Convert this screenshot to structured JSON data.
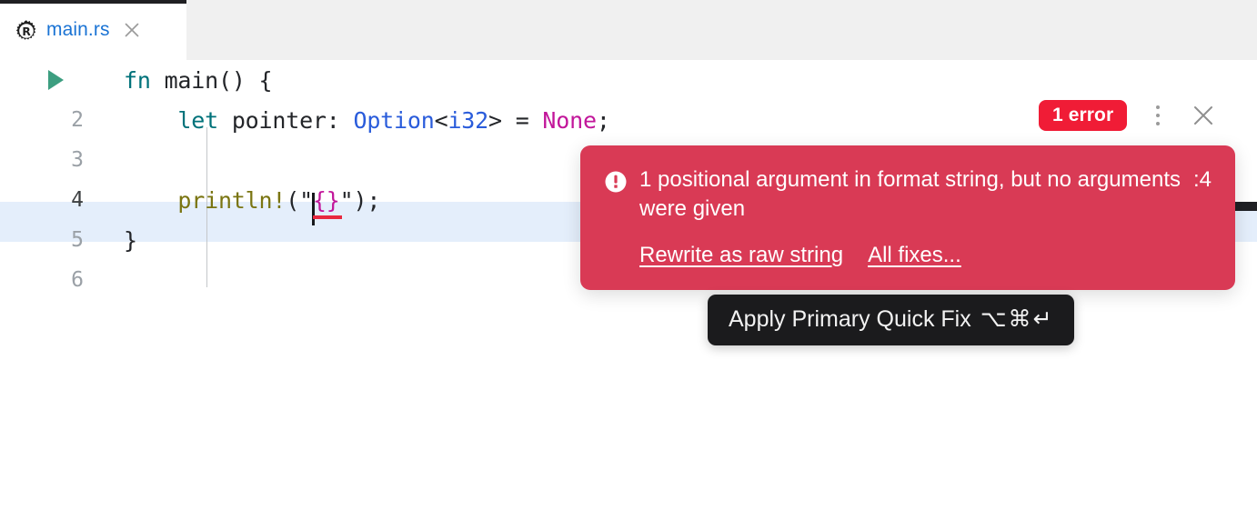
{
  "window": {
    "background_color": "#ffffff",
    "tabbar_background_color": "#f0f0f0"
  },
  "tabbar": {
    "tabs": [
      {
        "label": "main.rs",
        "icon": "rust-file-icon",
        "active": true,
        "close_icon": "close-icon",
        "label_color": "#1a73d4"
      }
    ]
  },
  "editor": {
    "current_line": 4,
    "current_line_highlight_color": "#e4eefb",
    "run_gutter_icon": "run-arrow-icon",
    "lines": [
      {
        "number": "1",
        "number_visible": false,
        "has_run_marker": true,
        "tokens": [
          {
            "text": "fn ",
            "style": "kw"
          },
          {
            "text": "main",
            "style": "plain"
          },
          {
            "text": "() {",
            "style": "plain"
          }
        ]
      },
      {
        "number": "2",
        "number_visible": true,
        "has_run_marker": false,
        "tokens": [
          {
            "text": "    ",
            "style": "plain"
          },
          {
            "text": "let ",
            "style": "kw"
          },
          {
            "text": "pointer: ",
            "style": "plain"
          },
          {
            "text": "Option",
            "style": "type"
          },
          {
            "text": "<",
            "style": "plain"
          },
          {
            "text": "i32",
            "style": "type"
          },
          {
            "text": "> = ",
            "style": "plain"
          },
          {
            "text": "None",
            "style": "lit"
          },
          {
            "text": ";",
            "style": "plain"
          }
        ]
      },
      {
        "number": "3",
        "number_visible": true,
        "has_run_marker": false,
        "tokens": []
      },
      {
        "number": "4",
        "number_visible": true,
        "has_run_marker": false,
        "tokens": [
          {
            "text": "    ",
            "style": "plain"
          },
          {
            "text": "println!",
            "style": "macro"
          },
          {
            "text": "(\"",
            "style": "plain"
          },
          {
            "text": "{}",
            "style": "fmt-error"
          },
          {
            "text": "\");",
            "style": "plain"
          }
        ]
      },
      {
        "number": "5",
        "number_visible": true,
        "has_run_marker": false,
        "tokens": [
          {
            "text": "}",
            "style": "plain"
          }
        ]
      },
      {
        "number": "6",
        "number_visible": true,
        "has_run_marker": false,
        "tokens": []
      }
    ],
    "syntax_colors": {
      "keyword": "#00727a",
      "type": "#2a5cdb",
      "macro": "#7a7512",
      "literal": "#c2169a",
      "plain": "#232529",
      "error_underline": "#e8283f"
    }
  },
  "error_toolbar": {
    "badge_label": "1 error",
    "badge_color": "#f01c36",
    "more_icon": "more-vertical-icon",
    "close_icon": "close-icon"
  },
  "error_popup": {
    "background_color": "#d93a55",
    "icon": "error-exclamation-icon",
    "message": "1 positional argument in format string, but no arguments were given",
    "location": ":4",
    "actions": [
      {
        "label": "Rewrite as raw string",
        "name": "rewrite-as-raw-string-link"
      },
      {
        "label": "All fixes...",
        "name": "all-fixes-link"
      }
    ]
  },
  "tooltip": {
    "label": "Apply Primary Quick Fix",
    "shortcut": "⌥⌘↵",
    "background_color": "#1b1b1d"
  }
}
